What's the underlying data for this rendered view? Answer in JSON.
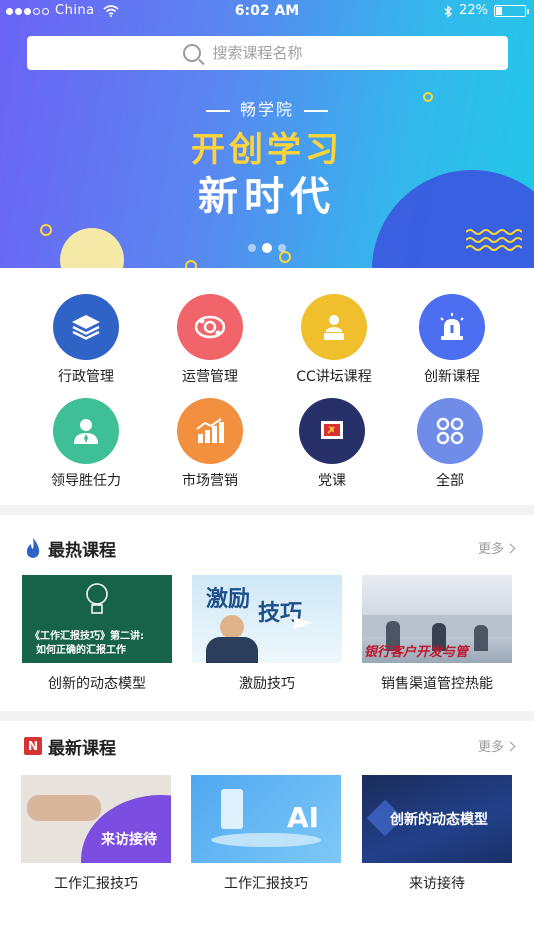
{
  "status_bar": {
    "carrier": "China",
    "time": "6:02 AM",
    "battery": "22%",
    "battery_level": 0.22
  },
  "search": {
    "placeholder": "搜索课程名称"
  },
  "banner": {
    "brand": "畅学院",
    "headline_line1": "开创学习",
    "headline_line2": "新时代"
  },
  "categories": [
    {
      "label": "行政管理",
      "icon": "layers-icon",
      "color": "#2f63c6"
    },
    {
      "label": "运营管理",
      "icon": "gear-cycle-icon",
      "color": "#f0646a"
    },
    {
      "label": "CC讲坛课程",
      "icon": "lecturer-icon",
      "color": "#f0bf2e"
    },
    {
      "label": "创新课程",
      "icon": "alarm-icon",
      "color": "#4c6ef0"
    },
    {
      "label": "领导胜任力",
      "icon": "leader-icon",
      "color": "#3fbf95"
    },
    {
      "label": "市场营销",
      "icon": "growth-chart-icon",
      "color": "#f3903f"
    },
    {
      "label": "党课",
      "icon": "party-flag-icon",
      "color": "#28306a"
    },
    {
      "label": "全部",
      "icon": "grid-circles-icon",
      "color": "#6f8ce8"
    }
  ],
  "hot_section": {
    "title": "最热课程",
    "more": "更多",
    "icon": "flame-icon",
    "courses": [
      {
        "title": "创新的动态模型",
        "thumb_text_1": "《工作汇报技巧》第二讲:",
        "thumb_text_2": "如何正确的汇报工作"
      },
      {
        "title": "激励技巧",
        "thumb_text_1": "激励",
        "thumb_text_2": "技巧"
      },
      {
        "title": "销售渠道管控热能",
        "thumb_text_1": "银行客户开发与管"
      }
    ]
  },
  "new_section": {
    "title": "最新课程",
    "more": "更多",
    "icon": "new-badge-icon",
    "badge": "N",
    "courses": [
      {
        "title": "工作汇报技巧",
        "thumb_text_1": "来访接待"
      },
      {
        "title": "工作汇报技巧",
        "thumb_text_1": "AI"
      },
      {
        "title": "来访接待",
        "thumb_text_1": "创新的动态模型"
      }
    ]
  }
}
